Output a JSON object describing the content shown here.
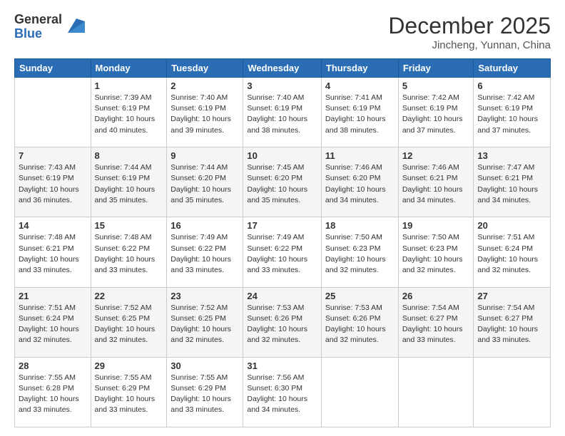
{
  "logo": {
    "general": "General",
    "blue": "Blue"
  },
  "header": {
    "month": "December 2025",
    "location": "Jincheng, Yunnan, China"
  },
  "weekdays": [
    "Sunday",
    "Monday",
    "Tuesday",
    "Wednesday",
    "Thursday",
    "Friday",
    "Saturday"
  ],
  "weeks": [
    [
      {
        "day": "",
        "info": ""
      },
      {
        "day": "1",
        "info": "Sunrise: 7:39 AM\nSunset: 6:19 PM\nDaylight: 10 hours\nand 40 minutes."
      },
      {
        "day": "2",
        "info": "Sunrise: 7:40 AM\nSunset: 6:19 PM\nDaylight: 10 hours\nand 39 minutes."
      },
      {
        "day": "3",
        "info": "Sunrise: 7:40 AM\nSunset: 6:19 PM\nDaylight: 10 hours\nand 38 minutes."
      },
      {
        "day": "4",
        "info": "Sunrise: 7:41 AM\nSunset: 6:19 PM\nDaylight: 10 hours\nand 38 minutes."
      },
      {
        "day": "5",
        "info": "Sunrise: 7:42 AM\nSunset: 6:19 PM\nDaylight: 10 hours\nand 37 minutes."
      },
      {
        "day": "6",
        "info": "Sunrise: 7:42 AM\nSunset: 6:19 PM\nDaylight: 10 hours\nand 37 minutes."
      }
    ],
    [
      {
        "day": "7",
        "info": "Sunrise: 7:43 AM\nSunset: 6:19 PM\nDaylight: 10 hours\nand 36 minutes."
      },
      {
        "day": "8",
        "info": "Sunrise: 7:44 AM\nSunset: 6:19 PM\nDaylight: 10 hours\nand 35 minutes."
      },
      {
        "day": "9",
        "info": "Sunrise: 7:44 AM\nSunset: 6:20 PM\nDaylight: 10 hours\nand 35 minutes."
      },
      {
        "day": "10",
        "info": "Sunrise: 7:45 AM\nSunset: 6:20 PM\nDaylight: 10 hours\nand 35 minutes."
      },
      {
        "day": "11",
        "info": "Sunrise: 7:46 AM\nSunset: 6:20 PM\nDaylight: 10 hours\nand 34 minutes."
      },
      {
        "day": "12",
        "info": "Sunrise: 7:46 AM\nSunset: 6:21 PM\nDaylight: 10 hours\nand 34 minutes."
      },
      {
        "day": "13",
        "info": "Sunrise: 7:47 AM\nSunset: 6:21 PM\nDaylight: 10 hours\nand 34 minutes."
      }
    ],
    [
      {
        "day": "14",
        "info": "Sunrise: 7:48 AM\nSunset: 6:21 PM\nDaylight: 10 hours\nand 33 minutes."
      },
      {
        "day": "15",
        "info": "Sunrise: 7:48 AM\nSunset: 6:22 PM\nDaylight: 10 hours\nand 33 minutes."
      },
      {
        "day": "16",
        "info": "Sunrise: 7:49 AM\nSunset: 6:22 PM\nDaylight: 10 hours\nand 33 minutes."
      },
      {
        "day": "17",
        "info": "Sunrise: 7:49 AM\nSunset: 6:22 PM\nDaylight: 10 hours\nand 33 minutes."
      },
      {
        "day": "18",
        "info": "Sunrise: 7:50 AM\nSunset: 6:23 PM\nDaylight: 10 hours\nand 32 minutes."
      },
      {
        "day": "19",
        "info": "Sunrise: 7:50 AM\nSunset: 6:23 PM\nDaylight: 10 hours\nand 32 minutes."
      },
      {
        "day": "20",
        "info": "Sunrise: 7:51 AM\nSunset: 6:24 PM\nDaylight: 10 hours\nand 32 minutes."
      }
    ],
    [
      {
        "day": "21",
        "info": "Sunrise: 7:51 AM\nSunset: 6:24 PM\nDaylight: 10 hours\nand 32 minutes."
      },
      {
        "day": "22",
        "info": "Sunrise: 7:52 AM\nSunset: 6:25 PM\nDaylight: 10 hours\nand 32 minutes."
      },
      {
        "day": "23",
        "info": "Sunrise: 7:52 AM\nSunset: 6:25 PM\nDaylight: 10 hours\nand 32 minutes."
      },
      {
        "day": "24",
        "info": "Sunrise: 7:53 AM\nSunset: 6:26 PM\nDaylight: 10 hours\nand 32 minutes."
      },
      {
        "day": "25",
        "info": "Sunrise: 7:53 AM\nSunset: 6:26 PM\nDaylight: 10 hours\nand 32 minutes."
      },
      {
        "day": "26",
        "info": "Sunrise: 7:54 AM\nSunset: 6:27 PM\nDaylight: 10 hours\nand 33 minutes."
      },
      {
        "day": "27",
        "info": "Sunrise: 7:54 AM\nSunset: 6:27 PM\nDaylight: 10 hours\nand 33 minutes."
      }
    ],
    [
      {
        "day": "28",
        "info": "Sunrise: 7:55 AM\nSunset: 6:28 PM\nDaylight: 10 hours\nand 33 minutes."
      },
      {
        "day": "29",
        "info": "Sunrise: 7:55 AM\nSunset: 6:29 PM\nDaylight: 10 hours\nand 33 minutes."
      },
      {
        "day": "30",
        "info": "Sunrise: 7:55 AM\nSunset: 6:29 PM\nDaylight: 10 hours\nand 33 minutes."
      },
      {
        "day": "31",
        "info": "Sunrise: 7:56 AM\nSunset: 6:30 PM\nDaylight: 10 hours\nand 34 minutes."
      },
      {
        "day": "",
        "info": ""
      },
      {
        "day": "",
        "info": ""
      },
      {
        "day": "",
        "info": ""
      }
    ]
  ]
}
